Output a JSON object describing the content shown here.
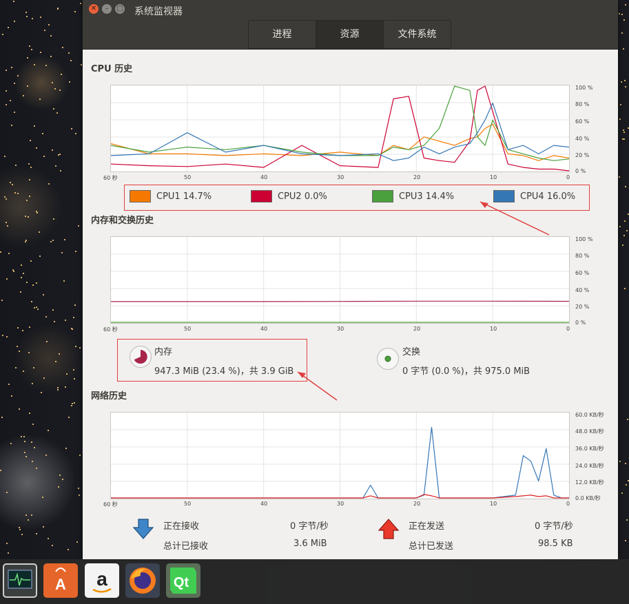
{
  "window": {
    "title": "系统监视器",
    "tabs": [
      "进程",
      "资源",
      "文件系统"
    ],
    "active_tab": "资源"
  },
  "cpu": {
    "title": "CPU 历史",
    "y_ticks": [
      "100 %",
      "80 %",
      "60 %",
      "40 %",
      "20 %",
      "0 %"
    ],
    "x_ticks": [
      "60 秒",
      "50",
      "40",
      "30",
      "20",
      "10",
      "0"
    ],
    "legend": [
      {
        "name": "CPU1",
        "value": "14.7%",
        "color": "#f57900"
      },
      {
        "name": "CPU2",
        "value": "0.0%",
        "color": "#cc0033"
      },
      {
        "name": "CPU3",
        "value": "14.4%",
        "color": "#4aa03c"
      },
      {
        "name": "CPU4",
        "value": "16.0%",
        "color": "#3577b5"
      }
    ]
  },
  "memory": {
    "title": "内存和交换历史",
    "y_ticks": [
      "100 %",
      "80 %",
      "60 %",
      "40 %",
      "20 %",
      "0 %"
    ],
    "x_ticks": [
      "60 秒",
      "50",
      "40",
      "30",
      "20",
      "10",
      "0"
    ],
    "mem_label": "内存",
    "mem_value": "947.3 MiB (23.4 %)，共 3.9 GiB",
    "mem_color": "#a7244b",
    "swap_label": "交换",
    "swap_value": "0 字节 (0.0 %)，共 975.0 MiB",
    "swap_color": "#4aa03c"
  },
  "network": {
    "title": "网络历史",
    "y_ticks": [
      "60.0 KB/秒",
      "48.0 KB/秒",
      "36.0 KB/秒",
      "24.0 KB/秒",
      "12.0 KB/秒",
      "0.0 KB/秒"
    ],
    "x_ticks": [
      "60 秒",
      "50",
      "40",
      "30",
      "20",
      "10",
      "0"
    ],
    "receiving_label": "正在接收",
    "receiving_value": "0 字节/秒",
    "total_received_label": "总计已接收",
    "total_received_value": "3.6 MiB",
    "sending_label": "正在发送",
    "sending_value": "0 字节/秒",
    "total_sent_label": "总计已发送",
    "total_sent_value": "98.5 KB",
    "receive_color": "#3577b5",
    "send_color": "#e02020"
  },
  "dock": {
    "icons": [
      "system-monitor-icon",
      "software-center-icon",
      "amazon-icon",
      "firefox-icon",
      "qt-creator-icon"
    ]
  },
  "chart_data": [
    {
      "type": "line",
      "title": "CPU 历史",
      "x": [
        60,
        55,
        50,
        45,
        40,
        35,
        30,
        25,
        23,
        21,
        19,
        17,
        15,
        13,
        12,
        11,
        10,
        8,
        6,
        4,
        2,
        0
      ],
      "ylim": [
        0,
        100
      ],
      "series": [
        {
          "name": "CPU1",
          "values": [
            32,
            20,
            20,
            18,
            20,
            18,
            22,
            18,
            30,
            25,
            40,
            35,
            30,
            38,
            40,
            50,
            55,
            20,
            18,
            12,
            18,
            15
          ]
        },
        {
          "name": "CPU2",
          "values": [
            8,
            6,
            5,
            8,
            4,
            30,
            6,
            4,
            85,
            88,
            15,
            12,
            10,
            35,
            95,
            100,
            70,
            8,
            4,
            2,
            2,
            0
          ]
        },
        {
          "name": "CPU3",
          "values": [
            30,
            22,
            28,
            25,
            30,
            22,
            18,
            18,
            28,
            25,
            30,
            50,
            100,
            95,
            40,
            30,
            60,
            25,
            20,
            15,
            12,
            14
          ]
        },
        {
          "name": "CPU4",
          "values": [
            18,
            20,
            45,
            22,
            30,
            20,
            18,
            20,
            12,
            15,
            28,
            20,
            28,
            32,
            45,
            60,
            80,
            25,
            30,
            20,
            30,
            28
          ]
        }
      ]
    },
    {
      "type": "line",
      "title": "内存和交换历史",
      "x": [
        60,
        50,
        40,
        30,
        20,
        10,
        0
      ],
      "ylim": [
        0,
        100
      ],
      "series": [
        {
          "name": "内存",
          "values": [
            24.5,
            24.5,
            24.5,
            24.6,
            25,
            25,
            24.8
          ]
        },
        {
          "name": "交换",
          "values": [
            0,
            0,
            0,
            0,
            0,
            0,
            0
          ]
        }
      ]
    },
    {
      "type": "line",
      "title": "网络历史",
      "x": [
        60,
        40,
        30,
        27,
        26,
        25,
        20,
        19,
        18,
        17,
        16,
        10,
        7,
        6,
        5,
        4,
        3,
        2,
        1,
        0
      ],
      "ylim": [
        0,
        60
      ],
      "series": [
        {
          "name": "正在接收",
          "values": [
            0,
            0,
            0,
            0,
            9,
            0,
            0,
            2,
            50,
            0,
            0,
            0,
            2,
            30,
            26,
            12,
            35,
            2,
            0,
            0
          ]
        },
        {
          "name": "正在发送",
          "values": [
            0,
            0,
            0,
            0,
            1.5,
            0,
            0,
            2.5,
            1.5,
            0,
            0,
            0,
            1,
            1.5,
            2,
            1,
            1.5,
            0,
            0,
            0
          ]
        }
      ]
    }
  ]
}
